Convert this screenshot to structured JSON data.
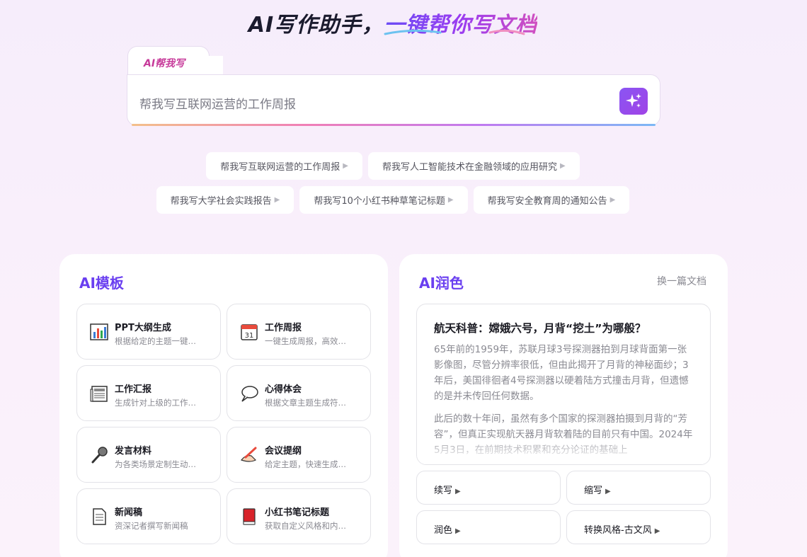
{
  "hero": {
    "title_plain": "AI写作助手，",
    "title_accent": "一键帮你写文档"
  },
  "composer": {
    "tab_label": "AI帮我写",
    "input_value": "帮我写互联网运营的工作周报",
    "send_icon": "sparkle-icon"
  },
  "suggestions": {
    "row1": [
      "帮我写互联网运营的工作周报",
      "帮我写人工智能技术在金融领域的应用研究"
    ],
    "row2": [
      "帮我写大学社会实践报告",
      "帮我写10个小红书种草笔记标题",
      "帮我写安全教育周的通知公告"
    ]
  },
  "templates": {
    "title": "AI模板",
    "items": [
      {
        "name": "PPT大纲生成",
        "desc": "根据给定的主题一键…",
        "icon": "bar-chart-icon"
      },
      {
        "name": "工作周报",
        "desc": "一键生成周报，高效…",
        "icon": "calendar-icon"
      },
      {
        "name": "工作汇报",
        "desc": "生成针对上级的工作…",
        "icon": "newspaper-icon"
      },
      {
        "name": "心得体会",
        "desc": "根据文章主题生成符…",
        "icon": "speech-bubble-icon"
      },
      {
        "name": "发言材料",
        "desc": "为各类场景定制生动…",
        "icon": "microphone-icon"
      },
      {
        "name": "会议提纲",
        "desc": "给定主题，快速生成…",
        "icon": "writing-hand-icon"
      },
      {
        "name": "新闻稿",
        "desc": "资深记者撰写新闻稿",
        "icon": "document-icon"
      },
      {
        "name": "小红书笔记标题",
        "desc": "获取自定义风格和内…",
        "icon": "red-book-icon"
      }
    ]
  },
  "polish": {
    "title": "AI润色",
    "switch_link": "换一篇文档",
    "article_title": "航天科普：嫦娥六号，月背“挖土”为哪般？",
    "paragraphs": [
      "65年前的1959年，苏联月球3号探测器拍到月球背面第一张影像图，尽管分辨率很低，但由此揭开了月背的神秘面纱；3年后，美国徘徊者4号探测器以硬着陆方式撞击月背，但遗憾的是并未传回任何数据。",
      "此后的数十年间，虽然有多个国家的探测器拍摄到月背的“芳容”，但真正实现航天器月背软着陆的目前只有中国。2024年5月3日，在前期技术积累和充分论证的基础上"
    ],
    "actions": [
      "续写",
      "缩写",
      "润色",
      "转换风格-古文风"
    ]
  }
}
